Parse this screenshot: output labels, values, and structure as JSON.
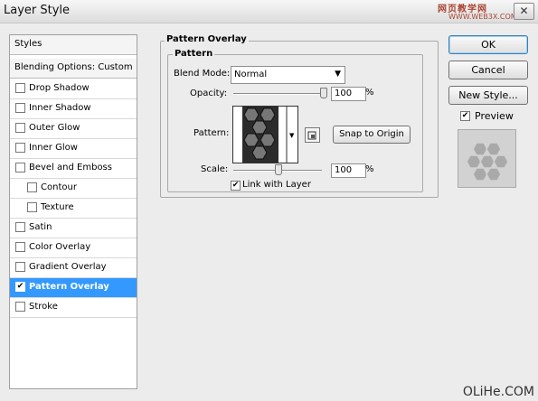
{
  "window": {
    "title": "Layer Style",
    "close_glyph": "✕",
    "watermark_top": "网页教学网",
    "watermark_sub": "WWW.WEB3X.COM",
    "watermark_bottom": "OLiHe.COM"
  },
  "sidebar": {
    "styles_label": "Styles",
    "blending_label": "Blending Options: Custom",
    "items": [
      {
        "label": "Drop Shadow",
        "checked": false,
        "indent": false
      },
      {
        "label": "Inner Shadow",
        "checked": false,
        "indent": false
      },
      {
        "label": "Outer Glow",
        "checked": false,
        "indent": false
      },
      {
        "label": "Inner Glow",
        "checked": false,
        "indent": false
      },
      {
        "label": "Bevel and Emboss",
        "checked": false,
        "indent": false
      },
      {
        "label": "Contour",
        "checked": false,
        "indent": true
      },
      {
        "label": "Texture",
        "checked": false,
        "indent": true
      },
      {
        "label": "Satin",
        "checked": false,
        "indent": false
      },
      {
        "label": "Color Overlay",
        "checked": false,
        "indent": false
      },
      {
        "label": "Gradient Overlay",
        "checked": false,
        "indent": false
      },
      {
        "label": "Pattern Overlay",
        "checked": true,
        "indent": false,
        "selected": true
      },
      {
        "label": "Stroke",
        "checked": false,
        "indent": false
      }
    ]
  },
  "panel": {
    "group_title": "Pattern Overlay",
    "subgroup_title": "Pattern",
    "blend_mode_label": "Blend Mode:",
    "blend_mode_value": "Normal",
    "opacity_label": "Opacity:",
    "opacity_value": "100",
    "opacity_unit": "%",
    "opacity_level": 1.0,
    "pattern_label": "Pattern:",
    "snap_button": "Snap to Origin",
    "scale_label": "Scale:",
    "scale_value": "100",
    "scale_unit": "%",
    "link_label": "Link with Layer",
    "link_checked": true
  },
  "actions": {
    "ok": "OK",
    "cancel": "Cancel",
    "new_style": "New Style...",
    "preview_label": "Preview",
    "preview_checked": true
  },
  "icons": {
    "checkmark": "✔",
    "dropdown_arrow": "▼",
    "menu_arrow": "▸"
  },
  "colors": {
    "selection": "#3399ff",
    "dialog_bg": "#ececec"
  }
}
